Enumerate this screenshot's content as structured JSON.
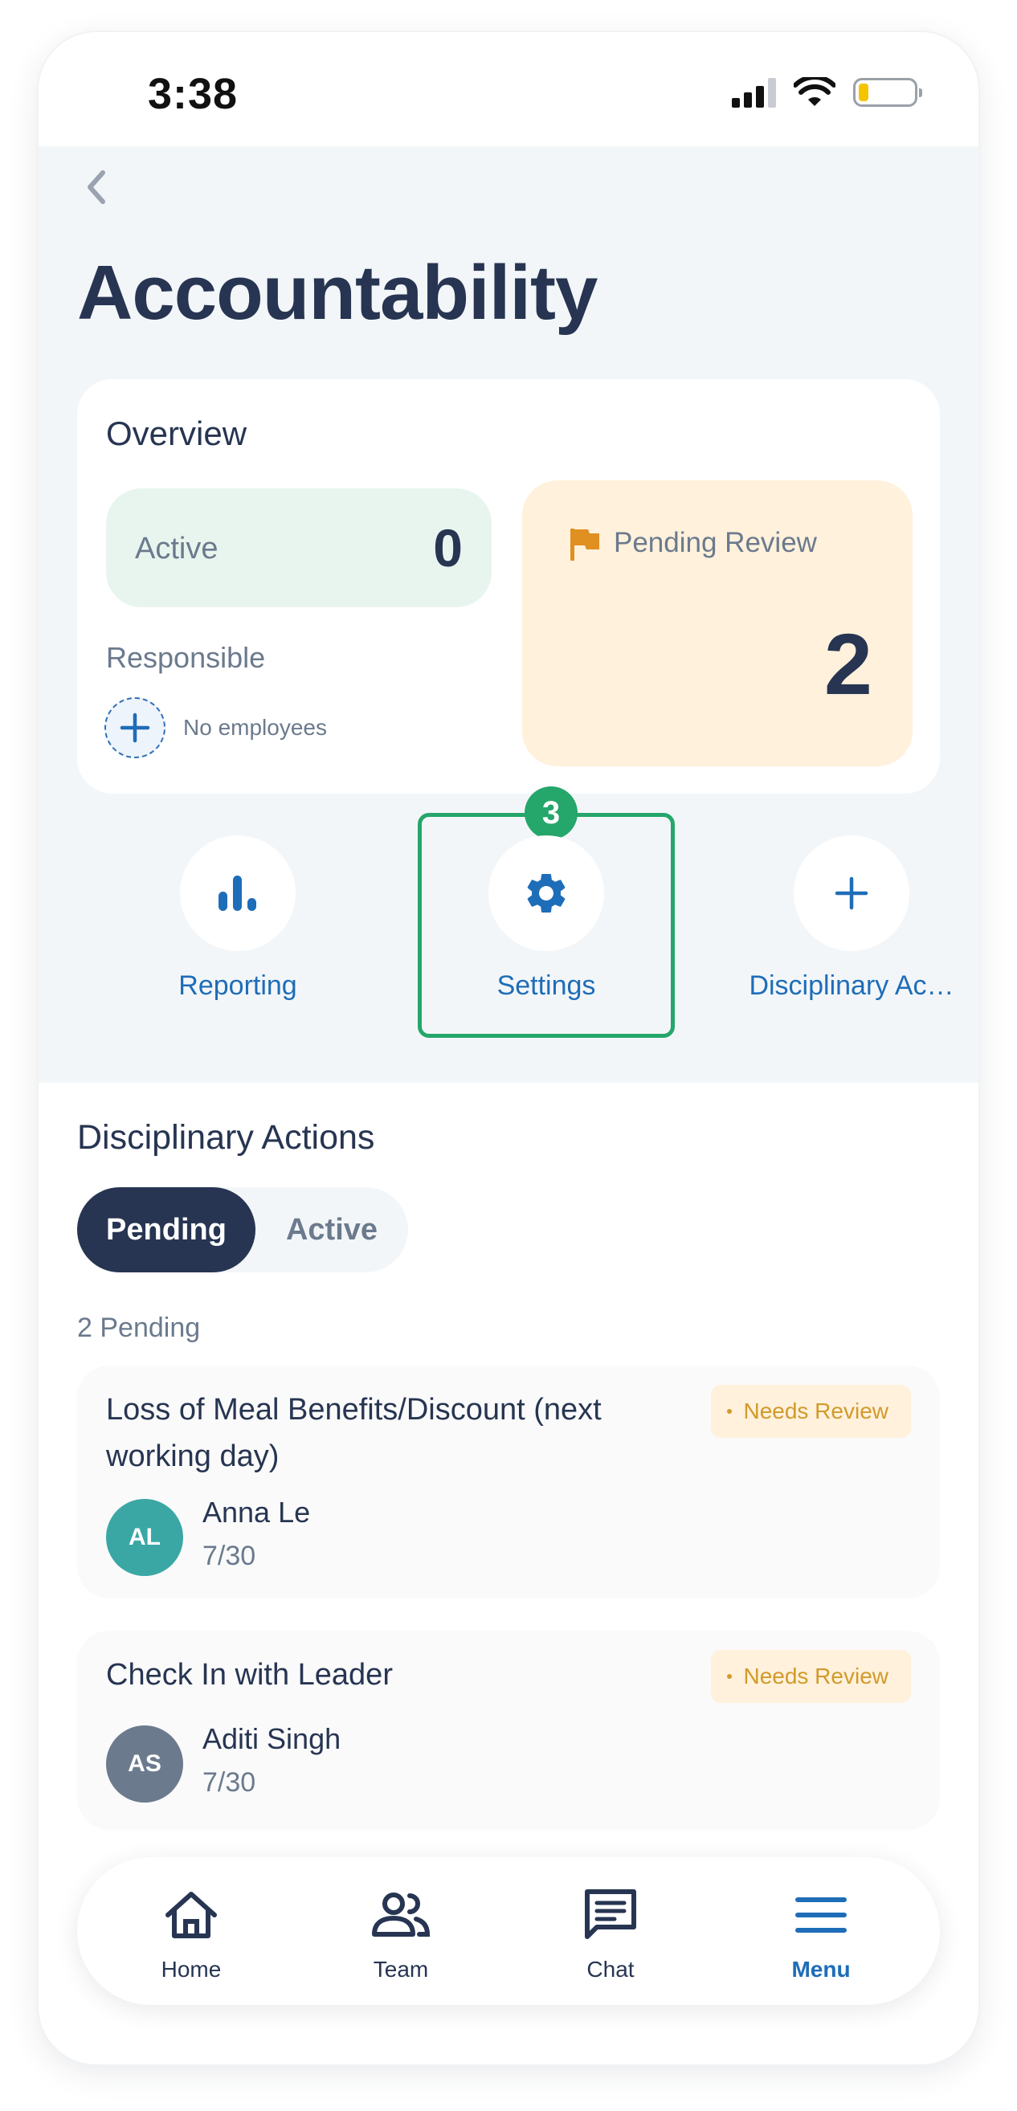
{
  "status_bar": {
    "time": "3:38"
  },
  "page": {
    "title": "Accountability"
  },
  "overview": {
    "title": "Overview",
    "active_label": "Active",
    "active_value": "0",
    "responsible_label": "Responsible",
    "no_employees": "No employees",
    "pending_label": "Pending Review",
    "pending_value": "2"
  },
  "quick_actions": [
    {
      "label": "Reporting",
      "icon": "bar-chart-icon"
    },
    {
      "label": "Settings",
      "icon": "gear-icon",
      "badge": "3"
    },
    {
      "label": "Disciplinary Ac…",
      "icon": "plus-icon"
    }
  ],
  "disciplinary": {
    "title": "Disciplinary Actions",
    "tabs": [
      "Pending",
      "Active"
    ],
    "selected_tab": "Pending",
    "count_label": "2 Pending",
    "items": [
      {
        "title": "Loss of Meal Benefits/Discount (next working day)",
        "status": "Needs Review",
        "initials": "AL",
        "name": "Anna Le",
        "date": "7/30",
        "avatar_color": "#3aa7a5"
      },
      {
        "title": "Check In with Leader",
        "status": "Needs Review",
        "initials": "AS",
        "name": "Aditi Singh",
        "date": "7/30",
        "avatar_color": "#6c7a8e"
      }
    ]
  },
  "bottom_nav": [
    {
      "label": "Home",
      "icon": "home-icon"
    },
    {
      "label": "Team",
      "icon": "team-icon"
    },
    {
      "label": "Chat",
      "icon": "chat-icon"
    },
    {
      "label": "Menu",
      "icon": "menu-icon",
      "active": true
    }
  ],
  "colors": {
    "primary": "#273552",
    "accent_blue": "#1e6db8",
    "highlight_green": "#25a66a",
    "pending_bg": "#fff1dc",
    "active_bg": "#e8f5ef",
    "needs_review": "#d19a2a"
  }
}
